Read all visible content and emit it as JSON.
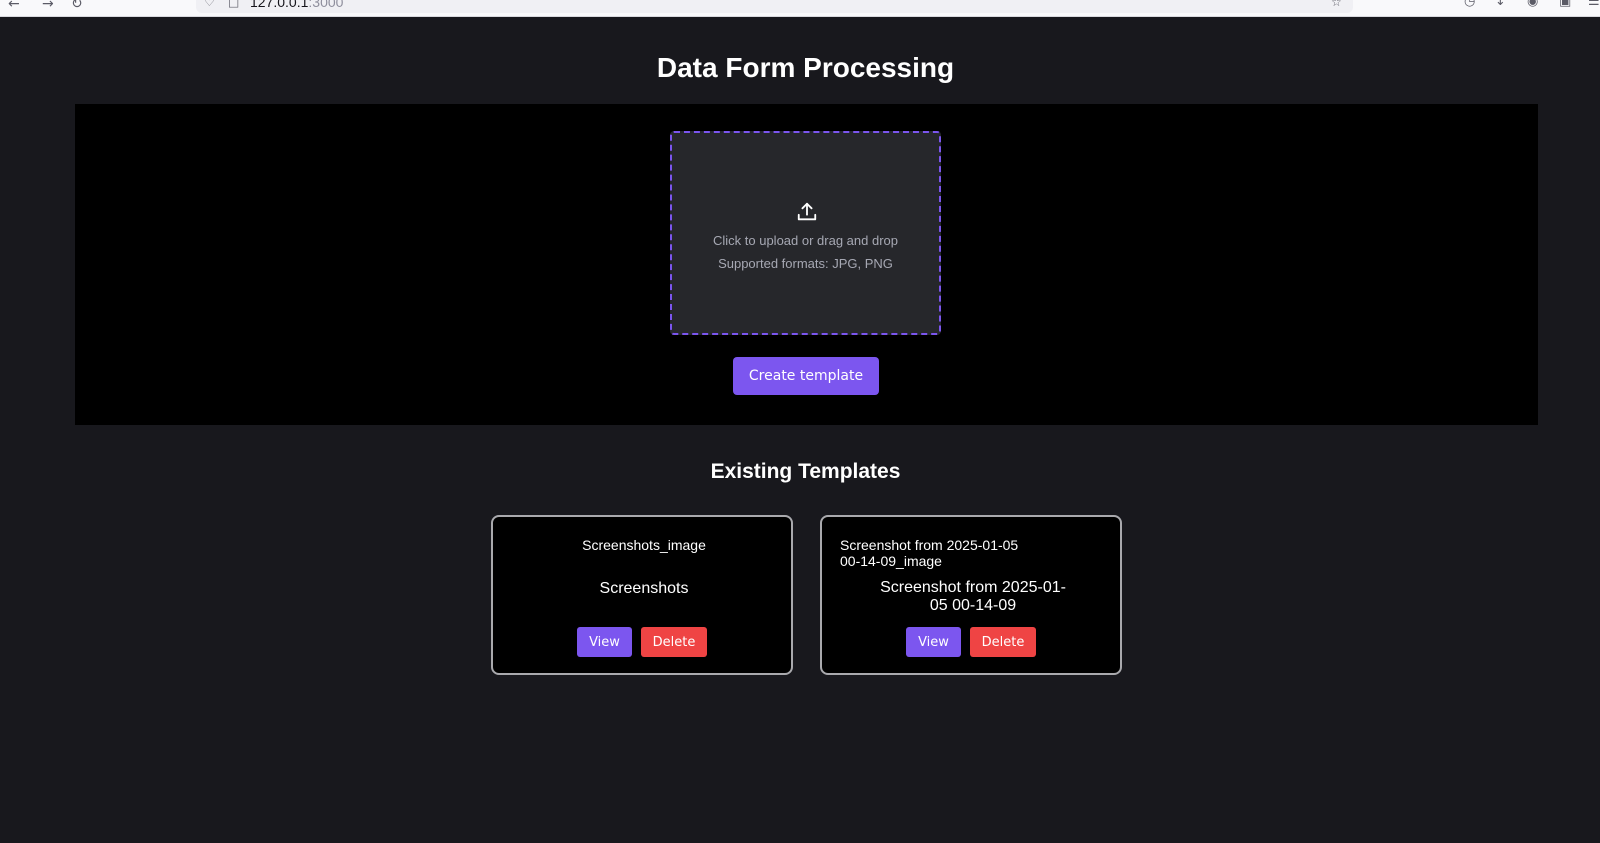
{
  "browser": {
    "url_host": "127.0.0.1",
    "url_port": ":3000"
  },
  "page": {
    "title": "Data Form Processing"
  },
  "upload": {
    "primary_text": "Click to upload or drag and drop",
    "formats_text": "Supported formats: JPG, PNG",
    "icon": "upload-icon",
    "accent_color": "#7b55ee"
  },
  "actions": {
    "create_label": "Create template"
  },
  "templates": {
    "heading": "Existing Templates",
    "items": [
      {
        "image_name": "Screenshots_image",
        "name": "Screenshots",
        "view_label": "View",
        "delete_label": "Delete"
      },
      {
        "image_name": "Screenshot from 2025-01-05 00-14-09_image",
        "name": "Screenshot from 2025-01-05 00-14-09",
        "view_label": "View",
        "delete_label": "Delete"
      }
    ]
  },
  "colors": {
    "primary": "#7c56ef",
    "danger": "#ef4444",
    "background": "#18181d"
  }
}
